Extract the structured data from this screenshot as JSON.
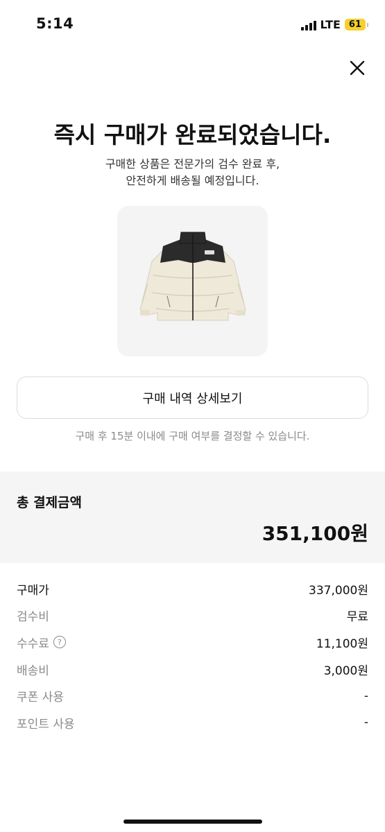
{
  "status_bar": {
    "time": "5:14",
    "network": "LTE",
    "battery": "61",
    "battery_color": "#f5d02e"
  },
  "header": {
    "close_icon": "close-icon"
  },
  "confirmation": {
    "title": "즉시 구매가 완료되었습니다.",
    "subtitle_line1": "구매한 상품은 전문가의 검수 완료 후,",
    "subtitle_line2": "안전하게 배송될 예정입니다."
  },
  "product": {
    "image": "puffer-jacket-image"
  },
  "actions": {
    "detail_button_label": "구매 내역 상세보기",
    "notice": "구매 후 15분 이내에 구매 여부를 결정할 수 있습니다."
  },
  "payment": {
    "total_label": "총 결제금액",
    "total_amount": "351,100원",
    "rows": [
      {
        "label": "구매가",
        "value": "337,000원"
      },
      {
        "label": "검수비",
        "value": "무료"
      },
      {
        "label": "수수료",
        "value": "11,100원",
        "help_icon": "question-icon"
      },
      {
        "label": "배송비",
        "value": "3,000원"
      },
      {
        "label": "쿠폰 사용",
        "value": "-"
      },
      {
        "label": "포인트 사용",
        "value": "-"
      }
    ]
  }
}
